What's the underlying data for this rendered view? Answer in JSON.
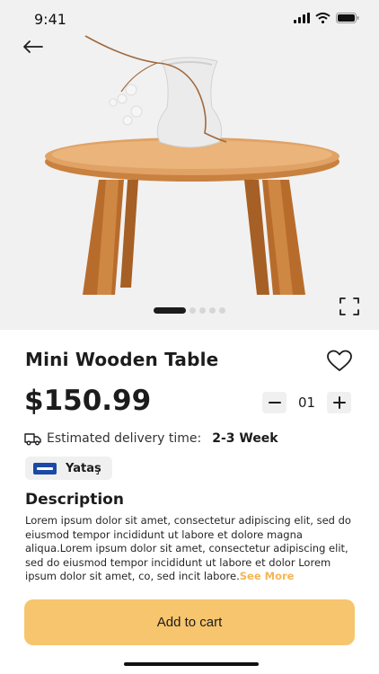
{
  "status_bar": {
    "time": "9:41"
  },
  "gallery": {
    "slide_count": 5,
    "active_index": 0
  },
  "product": {
    "title": "Mini Wooden Table",
    "price": "$150.99",
    "quantity": "01"
  },
  "delivery": {
    "label": "Estimated delivery time:",
    "value": "2-3 Week"
  },
  "brand": {
    "name": "Yataş"
  },
  "description": {
    "heading": "Description",
    "body": "Lorem ipsum dolor sit amet, consectetur adipiscing elit, sed do eiusmod tempor incididunt ut labore et dolore magna aliqua.Lorem ipsum dolor sit amet, consectetur adipiscing elit, sed do eiusmod tempor incididunt ut labore et dolor Lorem ipsum dolor sit amet, co, sed incit labore.",
    "see_more": "See More"
  },
  "cart": {
    "button_label": "Add to cart"
  },
  "icons": {
    "back": "arrow-left-icon",
    "expand": "expand-icon",
    "favorite": "heart-icon",
    "minus": "minus-icon",
    "plus": "plus-icon",
    "delivery": "truck-icon"
  },
  "colors": {
    "accent": "#f7c56d",
    "see_more": "#f4b555",
    "hero_bg": "#f1f1f1",
    "brand_logo": "#1a49a6"
  }
}
